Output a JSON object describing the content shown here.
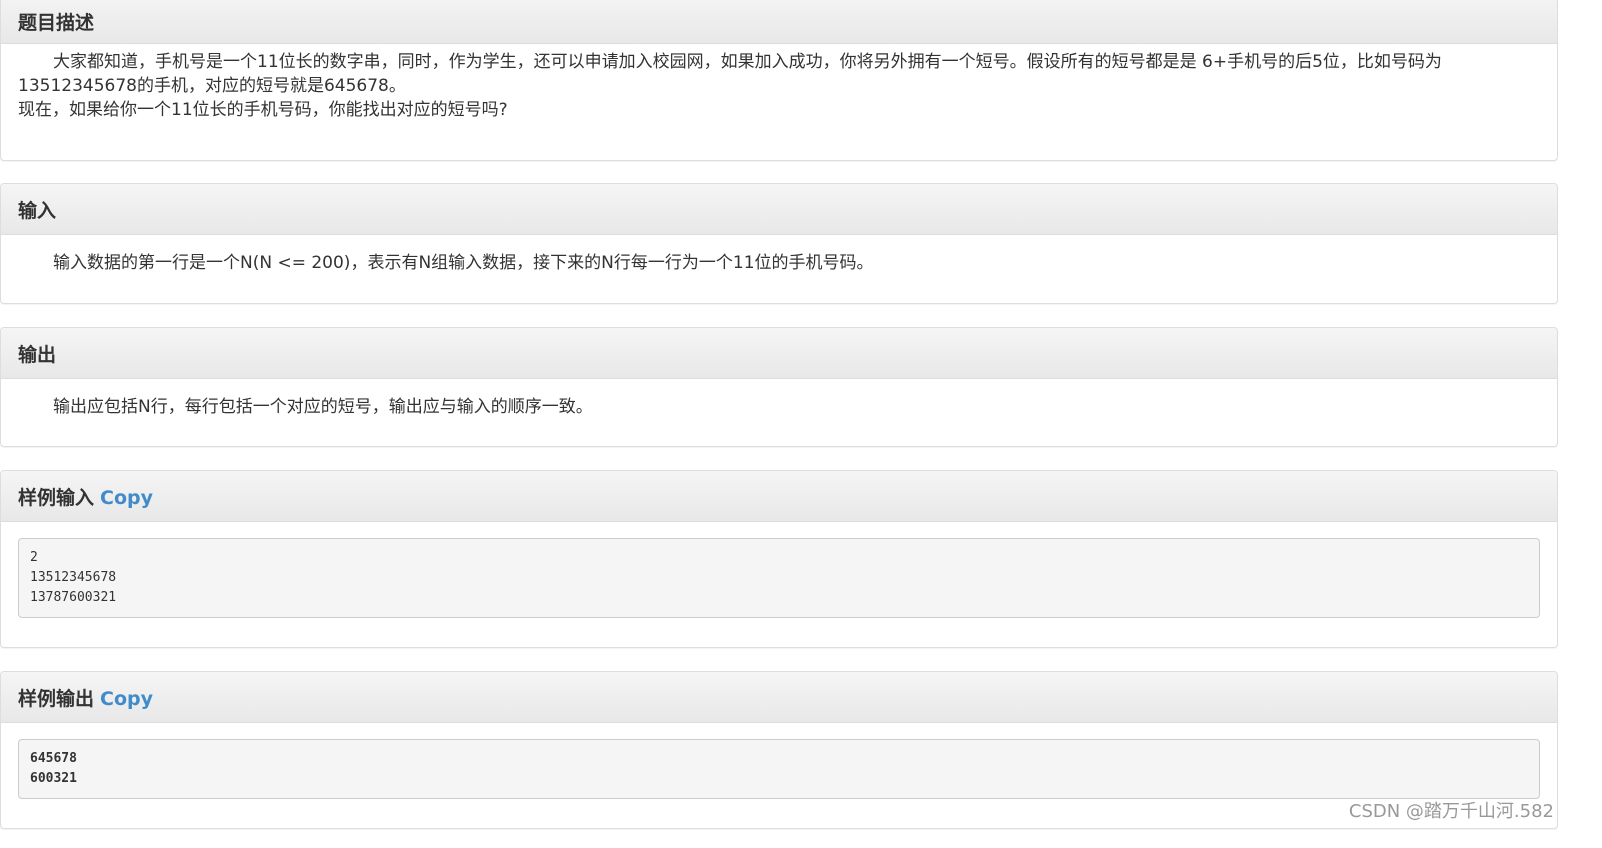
{
  "description": {
    "title": "题目描述",
    "line1": "大家都知道，手机号是一个11位长的数字串，同时，作为学生，还可以申请加入校园网，如果加入成功，你将另外拥有一个短号。假设所有的短号都是是 6+手机号的后5位，比如号码为",
    "line2": "13512345678的手机，对应的短号就是645678。",
    "line3": "现在，如果给你一个11位长的手机号码，你能找出对应的短号吗?"
  },
  "input": {
    "title": "输入",
    "text": "输入数据的第一行是一个N(N <= 200)，表示有N组输入数据，接下来的N行每一行为一个11位的手机号码。"
  },
  "output": {
    "title": "输出",
    "text": "输出应包括N行，每行包括一个对应的短号，输出应与输入的顺序一致。"
  },
  "sample_input": {
    "title": "样例输入",
    "copy_label": "Copy",
    "lines": [
      "2",
      "13512345678",
      "13787600321"
    ]
  },
  "sample_output": {
    "title": "样例输出",
    "copy_label": "Copy",
    "lines": [
      "645678",
      "600321"
    ]
  },
  "watermark": "CSDN @踏万千山河.582",
  "colors": {
    "link": "#428bca",
    "heading_bg": "#f5f5f5",
    "border": "#dddddd"
  }
}
